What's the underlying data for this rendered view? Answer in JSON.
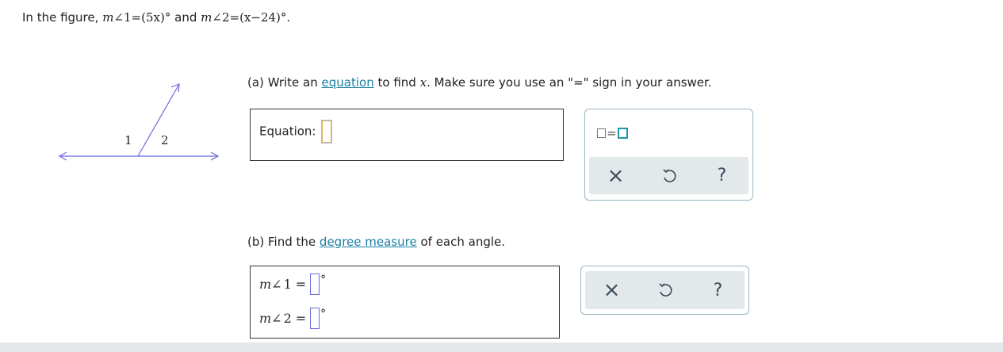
{
  "intro": {
    "prefix": "In the figure,",
    "m": "m",
    "angle": "∠",
    "one": "1",
    "eq": "=",
    "expr1": "(5x)°",
    "and": "and",
    "two": "2",
    "expr2": "(x−24)°."
  },
  "figure": {
    "label1": "1",
    "label2": "2",
    "line_color": "#6a6adf"
  },
  "partA": {
    "prefix": "(a)",
    "text1": "Write an",
    "link": "equation",
    "text2": "to find",
    "var": "x",
    "text3": ". Make sure you use an \"=\" sign in your answer.",
    "equation_label": "Equation:"
  },
  "partB": {
    "prefix": "(b)",
    "text1": "Find the",
    "link": "degree measure",
    "text2": "of each angle.",
    "row1": {
      "m": "m",
      "angle": "∠",
      "num": "1",
      "eq": "=",
      "deg": "°"
    },
    "row2": {
      "m": "m",
      "angle": "∠",
      "num": "2",
      "eq": "=",
      "deg": "°"
    }
  },
  "tools": {
    "template_icon": "box-equals-box-icon",
    "clear_icon": "×",
    "undo_icon": "undo-icon",
    "help_icon": "?",
    "accent": "#1a9aa8"
  }
}
